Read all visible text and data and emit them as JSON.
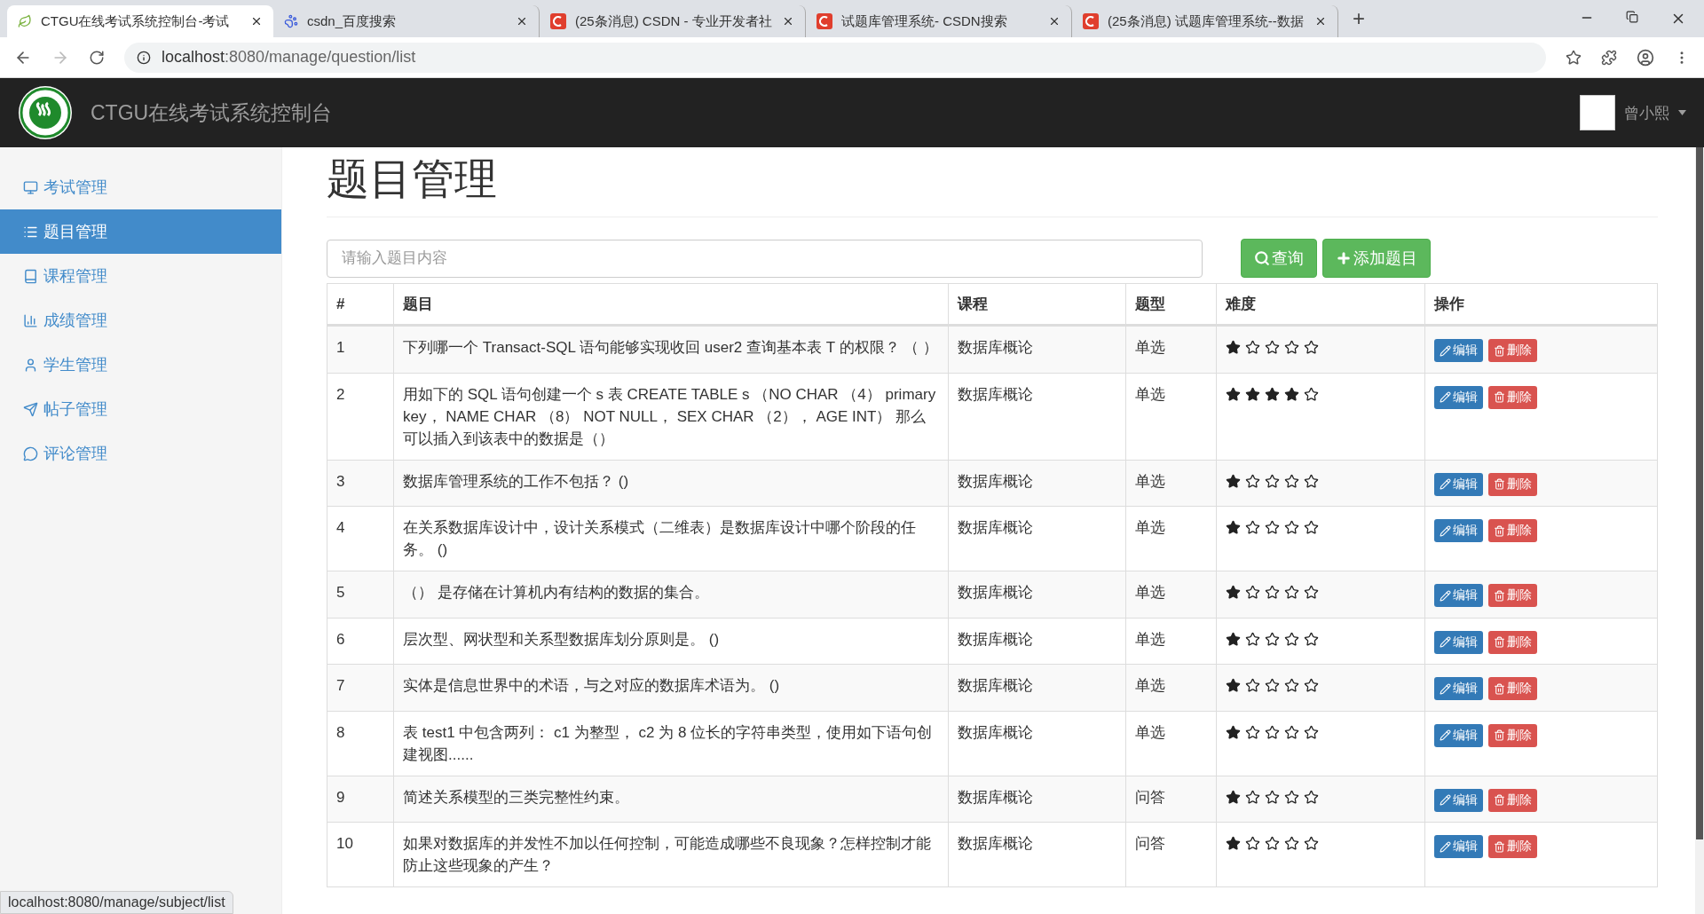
{
  "browser": {
    "tabs": [
      {
        "title": "CTGU在线考试系统控制台-考试",
        "selected": true
      },
      {
        "title": "csdn_百度搜索",
        "selected": false
      },
      {
        "title": "(25条消息) CSDN - 专业开发者社",
        "selected": false
      },
      {
        "title": "试题库管理系统- CSDN搜索",
        "selected": false
      },
      {
        "title": "(25条消息) 试题库管理系统--数据",
        "selected": false
      }
    ],
    "new_tab": "+",
    "url_host": "localhost",
    "url_path": ":8080/manage/question/list"
  },
  "navbar": {
    "title": "CTGU在线考试系统控制台",
    "user": "曾小熙"
  },
  "sidebar": {
    "items": [
      {
        "label": "考试管理",
        "selected": false
      },
      {
        "label": "题目管理",
        "selected": true
      },
      {
        "label": "课程管理",
        "selected": false
      },
      {
        "label": "成绩管理",
        "selected": false
      },
      {
        "label": "学生管理",
        "selected": false
      },
      {
        "label": "帖子管理",
        "selected": false
      },
      {
        "label": "评论管理",
        "selected": false
      }
    ]
  },
  "page": {
    "title": "题目管理",
    "search": {
      "placeholder": "请输入题目内容"
    },
    "buttons": [
      {
        "label": "查询",
        "kind": "search"
      },
      {
        "label": "添加题目",
        "kind": "add"
      }
    ]
  },
  "table": {
    "columns": [
      "#",
      "题目",
      "课程",
      "题型",
      "难度",
      "操作"
    ],
    "rows": [
      {
        "index": "1",
        "question": "下列哪一个 Transact-SQL 语句能够实现收回 user2 查询基本表 T 的权限？ （ ）",
        "course": "数据库概论",
        "type": "单选",
        "stars": 1,
        "actions": [
          "编辑",
          "删除"
        ]
      },
      {
        "index": "2",
        "question": "用如下的 SQL 语句创建一个 s 表 CREATE  TABLE  s  （NO  CHAR  （4） primary key，  NAME  CHAR  （8）  NOT  NULL，  SEX  CHAR  （2），  AGE  INT）  那么可以插入到该表中的数据是（）",
        "course": "数据库概论",
        "type": "单选",
        "stars": 4,
        "actions": [
          "编辑",
          "删除"
        ]
      },
      {
        "index": "3",
        "question": "数据库管理系统的工作不包括？ ()",
        "course": "数据库概论",
        "type": "单选",
        "stars": 1,
        "actions": [
          "编辑",
          "删除"
        ]
      },
      {
        "index": "4",
        "question": "在关系数据库设计中，设计关系模式（二维表）是数据库设计中哪个阶段的任务。 ()",
        "course": "数据库概论",
        "type": "单选",
        "stars": 1,
        "actions": [
          "编辑",
          "删除"
        ]
      },
      {
        "index": "5",
        "question": "（） 是存储在计算机内有结构的数据的集合。",
        "course": "数据库概论",
        "type": "单选",
        "stars": 1,
        "actions": [
          "编辑",
          "删除"
        ]
      },
      {
        "index": "6",
        "question": "层次型、网状型和关系型数据库划分原则是。 ()",
        "course": "数据库概论",
        "type": "单选",
        "stars": 1,
        "actions": [
          "编辑",
          "删除"
        ]
      },
      {
        "index": "7",
        "question": "实体是信息世界中的术语，与之对应的数据库术语为。 ()",
        "course": "数据库概论",
        "type": "单选",
        "stars": 1,
        "actions": [
          "编辑",
          "删除"
        ]
      },
      {
        "index": "8",
        "question": "表 test1 中包含两列： c1 为整型， c2 为 8 位长的字符串类型，使用如下语句创建视图......",
        "course": "数据库概论",
        "type": "单选",
        "stars": 1,
        "actions": [
          "编辑",
          "删除"
        ]
      },
      {
        "index": "9",
        "question": "简述关系模型的三类完整性约束。",
        "course": "数据库概论",
        "type": "问答",
        "stars": 1,
        "actions": [
          "编辑",
          "删除"
        ]
      },
      {
        "index": "10",
        "question": "如果对数据库的并发性不加以任何控制，可能造成哪些不良现象？怎样控制才能防止这些现象的产生？",
        "course": "数据库概论",
        "type": "问答",
        "stars": 1,
        "actions": [
          "编辑",
          "删除"
        ]
      }
    ]
  },
  "status_bar": "localhost:8080/manage/subject/list"
}
